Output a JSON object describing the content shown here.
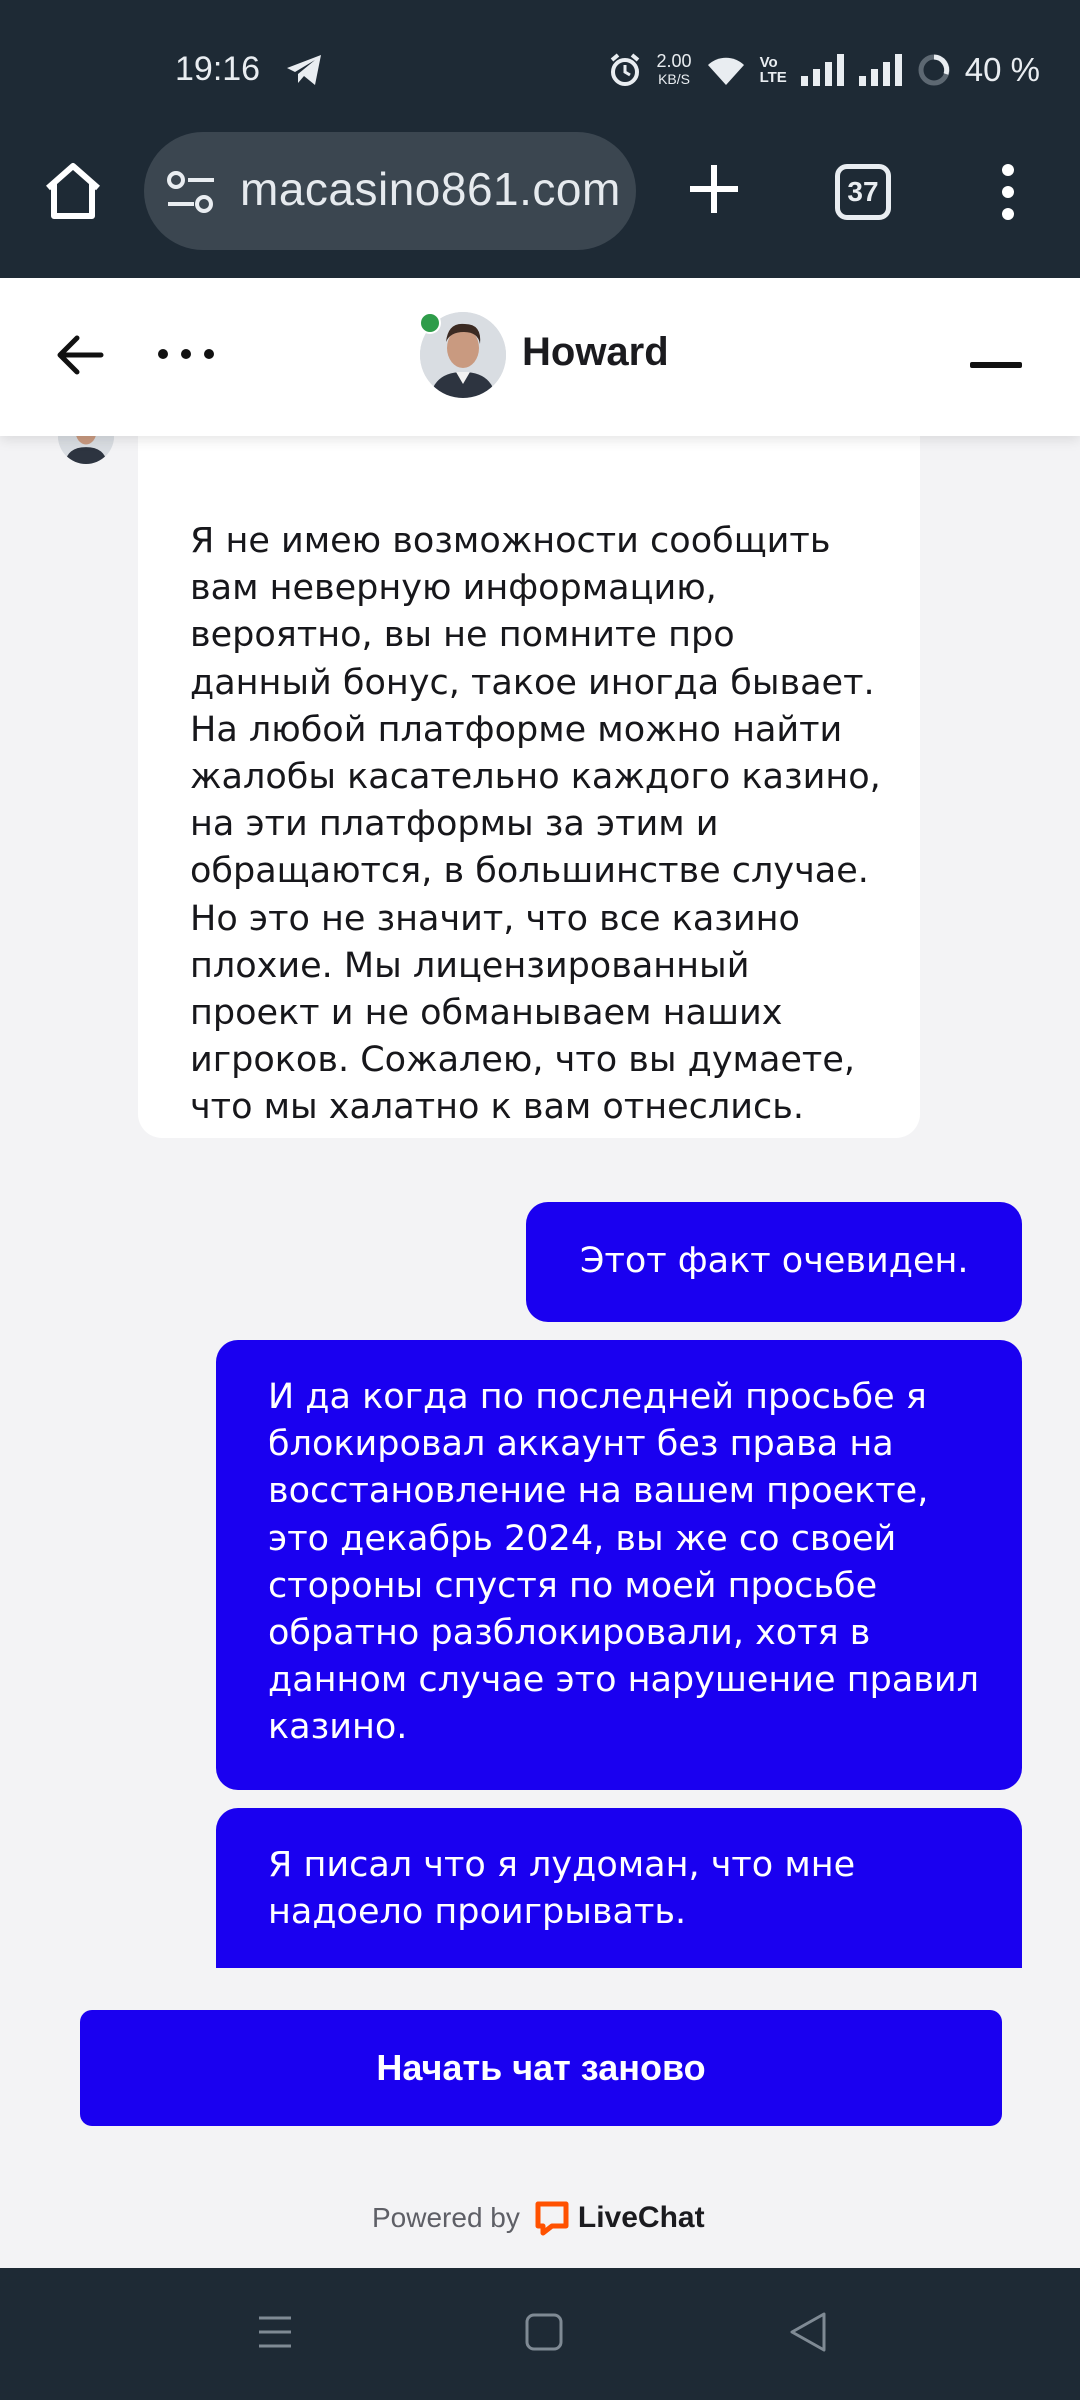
{
  "status_bar": {
    "time": "19:16",
    "net_speed_value": "2.00",
    "net_speed_unit": "KB/S",
    "volte": "Vo",
    "volte_sub": "LTE",
    "battery": "40 %"
  },
  "browser": {
    "url": "macasino861.com",
    "tab_count": "37"
  },
  "chat": {
    "agent_name": "Howard",
    "messages": [
      {
        "from": "agent",
        "text": "Я не имею возможности сообщить вам неверную информацию, вероятно, вы не помните про данный бонус, такое иногда бывает. На любой платформе можно найти жалобы касательно каждого казино, на эти платформы за этим и обращаются, в большинстве случае. Но это не значит, что все казино плохие. Мы лицензированный проект и не обманываем наших игроков. Сожалею, что вы думаете, что мы халатно к вам отнеслись."
      },
      {
        "from": "user",
        "text": "Этот факт очевиден."
      },
      {
        "from": "user",
        "text": "И да когда по последней просьбе я блокировал аккаунт без права на восстановление на вашем проекте, это декабрь 2024, вы же со своей стороны спустя по моей просьбе обратно разблокировали, хотя в данном случае это нарушение правил казино."
      },
      {
        "from": "user",
        "text": "Я писал что я лудоман, что мне надоело проигрывать."
      }
    ],
    "restart_label": "Начать чат заново",
    "powered_by": "Powered by",
    "brand": "LiveChat"
  },
  "colors": {
    "accent": "#1a00f0",
    "chrome": "#1e2a35",
    "online": "#2e9c4a",
    "brand_orange": "#ff5100"
  },
  "icons": [
    "telegram-icon",
    "alarm-icon",
    "wifi-icon",
    "signal-icon",
    "battery-icon",
    "home-icon",
    "site-settings-icon",
    "plus-icon",
    "more-vert-icon",
    "arrow-left-icon",
    "more-horiz-icon",
    "minimize-icon",
    "livechat-icon",
    "recent-apps-icon",
    "nav-home-icon",
    "nav-back-icon"
  ]
}
